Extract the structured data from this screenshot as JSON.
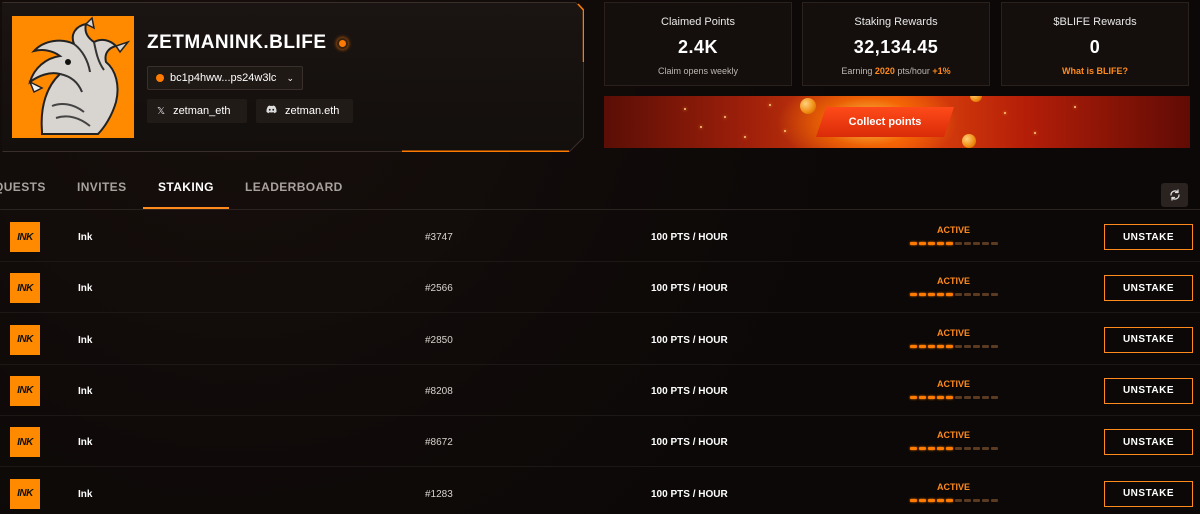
{
  "profile": {
    "username": "ZETMANINK.BLIFE",
    "wallet": "bc1p4hww...ps24w3lc",
    "twitter": "zetman_eth",
    "discord": "zetman.eth",
    "avatar_icon": "dragon-avatar"
  },
  "stats": {
    "claimed": {
      "label": "Claimed Points",
      "value": "2.4K",
      "sub": "Claim opens weekly"
    },
    "staking": {
      "label": "Staking Rewards",
      "value": "32,134.45",
      "sub_prefix": "Earning ",
      "rate": "2020",
      "sub_suffix": " pts/hour ",
      "boost": "+1%"
    },
    "blife": {
      "label": "$BLIFE Rewards",
      "value": "0",
      "link": "What is BLIFE?"
    }
  },
  "banner": {
    "button": "Collect points"
  },
  "tabs": [
    {
      "label": "QUESTS",
      "active": false
    },
    {
      "label": "INVITES",
      "active": false
    },
    {
      "label": "STAKING",
      "active": true
    },
    {
      "label": "LEADERBOARD",
      "active": false
    }
  ],
  "rows": [
    {
      "logo": "INK",
      "name": "Ink",
      "id": "#3747",
      "rate": "100 PTS / HOUR",
      "status": "ACTIVE",
      "action": "UNSTAKE"
    },
    {
      "logo": "INK",
      "name": "Ink",
      "id": "#2566",
      "rate": "100 PTS / HOUR",
      "status": "ACTIVE",
      "action": "UNSTAKE"
    },
    {
      "logo": "INK",
      "name": "Ink",
      "id": "#2850",
      "rate": "100 PTS / HOUR",
      "status": "ACTIVE",
      "action": "UNSTAKE"
    },
    {
      "logo": "INK",
      "name": "Ink",
      "id": "#8208",
      "rate": "100 PTS / HOUR",
      "status": "ACTIVE",
      "action": "UNSTAKE"
    },
    {
      "logo": "INK",
      "name": "Ink",
      "id": "#8672",
      "rate": "100 PTS / HOUR",
      "status": "ACTIVE",
      "action": "UNSTAKE"
    },
    {
      "logo": "INK",
      "name": "Ink",
      "id": "#1283",
      "rate": "100 PTS / HOUR",
      "status": "ACTIVE",
      "action": "UNSTAKE"
    }
  ],
  "colors": {
    "accent": "#ff8a1e",
    "background": "#0b0807",
    "card": "#140f0d"
  }
}
